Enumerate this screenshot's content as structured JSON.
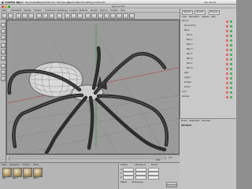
{
  "mac_menubar": {
    "app_name": "CINEMA 4D",
    "items": [
      "Datei",
      "Bearbeiten",
      "Objekte",
      "Struktur",
      "Werkzeuge",
      "Auswahl",
      "Zeichnen",
      "Plug-ins",
      "Fenster"
    ],
    "status_right": "Do 12:34"
  },
  "window": {
    "title": "spinne.c4d"
  },
  "app_menu": {
    "items": [
      "Datei",
      "Bearbeiten",
      "Objekte",
      "Struktur",
      "Funktionen",
      "Werkzeuge",
      "Auswahl",
      "Material",
      "Render",
      "Plug-ins",
      "Fenster",
      "Hilfe"
    ]
  },
  "viewport": {
    "label": "Zentralperspektive",
    "menu": [
      "Bearbeiten",
      "Kameras",
      "Darstellung",
      "Filter",
      "Ansicht"
    ]
  },
  "object_manager": {
    "tabs": [
      "Objekte",
      "Struktur",
      "Browser"
    ],
    "menu": [
      "Datei",
      "Bearbeiten",
      "Objekte",
      "Tags"
    ],
    "rows": [
      {
        "name": "Spinne",
        "indent": 0
      },
      {
        "name": "Spinne-Ring",
        "indent": 1
      },
      {
        "name": "Beine",
        "indent": 1
      },
      {
        "name": "Bein.1",
        "indent": 2
      },
      {
        "name": "Bein.2",
        "indent": 2
      },
      {
        "name": "Bein.3",
        "indent": 2
      },
      {
        "name": "Bein.4",
        "indent": 2
      },
      {
        "name": "Bein.5",
        "indent": 2
      },
      {
        "name": "Bein.6",
        "indent": 2
      },
      {
        "name": "Bein.7",
        "indent": 2
      },
      {
        "name": "Bein.8",
        "indent": 2
      },
      {
        "name": "Kopf",
        "indent": 1
      },
      {
        "name": "Augen",
        "indent": 1
      },
      {
        "name": "Zangen",
        "indent": 1
      },
      {
        "name": "Körper",
        "indent": 1
      },
      {
        "name": "Licht",
        "indent": 0
      },
      {
        "name": "Kamera",
        "indent": 0
      }
    ]
  },
  "attribute_manager": {
    "menu": [
      "Modus",
      "Bearbeiten",
      "Benutzer"
    ],
    "title": "Attribute"
  },
  "timeline": {
    "start": "0",
    "end": "90 B",
    "current": "0 B"
  },
  "materials": {
    "menu": [
      "Datei",
      "Bearbeiten",
      "Funktion",
      "Textur"
    ],
    "items": [
      "Mat",
      "Mat.1",
      "Mat.2",
      "Mat.3"
    ]
  },
  "coordinates": {
    "headers": [
      "Position",
      "Abmessung",
      "Winkel"
    ],
    "rows": [
      {
        "axis": "X",
        "pos": "0 m",
        "size": "0 m",
        "rot": "H 0°"
      },
      {
        "axis": "Y",
        "pos": "0 m",
        "size": "0 m",
        "rot": "P 0°"
      },
      {
        "axis": "Z",
        "pos": "0 m",
        "size": "0 m",
        "rot": "B 0°"
      }
    ],
    "mode_left": "Objekt",
    "mode_right": "Abmessung",
    "apply_label": "Anwenden"
  }
}
